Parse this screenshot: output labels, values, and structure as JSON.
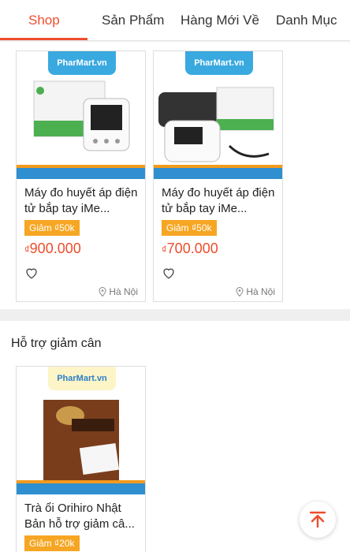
{
  "tabs": [
    "Shop",
    "Sản Phẩm",
    "Hàng Mới Về",
    "Danh Mục"
  ],
  "brand": {
    "logo_text": "PharMart.vn",
    "accent": "#ee4d2d",
    "discount_color": "#f6a623",
    "stripe_color": "#2f8fd0"
  },
  "products_section": {
    "items": [
      {
        "title": "Máy đo huyết áp điện tử bắp tay iMe...",
        "discount": "Giảm ₫50k",
        "currency": "₫",
        "price": "900.000",
        "location": "Hà Nội"
      },
      {
        "title": "Máy đo huyết áp điện tử bắp tay iMe...",
        "discount": "Giảm ₫50k",
        "currency": "₫",
        "price": "700.000",
        "location": "Hà Nội"
      }
    ]
  },
  "weight_section": {
    "title": "Hỗ trợ giảm cân",
    "items": [
      {
        "title": "Trà ổi Orihiro Nhật Bản hỗ trợ giảm câ...",
        "discount": "Giảm ₫20k"
      }
    ]
  },
  "icons": {
    "heart": "heart-icon",
    "location": "location-pin-icon",
    "back_to_top": "arrow-up-to-top-icon"
  }
}
